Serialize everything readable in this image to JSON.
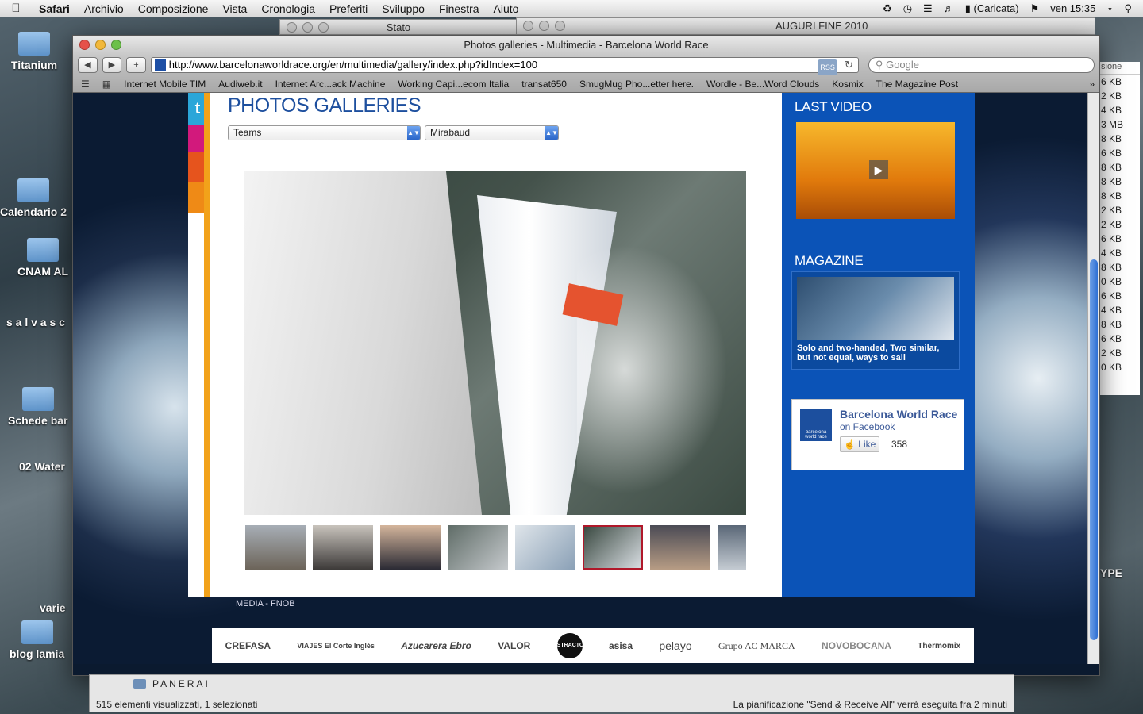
{
  "menubar": {
    "apple": "",
    "items": [
      "Safari",
      "Archivio",
      "Composizione",
      "Vista",
      "Cronologia",
      "Preferiti",
      "Sviluppo",
      "Finestra",
      "Aiuto"
    ],
    "battery": "(Caricata)",
    "clock": "ven 15:35"
  },
  "desktop": {
    "icons": [
      "Titanium",
      "Calendario 2",
      "CNAM AL",
      "s a l v a s c",
      "Schede bar",
      "02 Water",
      "varie",
      "blog lamia"
    ],
    "type_label": "YPE"
  },
  "bg_windows": {
    "stato_title": "Stato",
    "auguri_title": "AUGURI FINE 2010"
  },
  "sidelist": {
    "header": "sione",
    "rows": [
      "6 KB",
      "2 KB",
      "4 KB",
      "3 MB",
      "8 KB",
      "6 KB",
      "8 KB",
      "8 KB",
      "8 KB",
      "2 KB",
      "2 KB",
      "6 KB",
      "4 KB",
      "8 KB",
      "0 KB",
      "6 KB",
      "4 KB",
      "8 KB",
      "6 KB",
      "2 KB",
      "0 KB"
    ]
  },
  "safari": {
    "title": "Photos galleries - Multimedia - Barcelona World Race",
    "url": "http://www.barcelonaworldrace.org/en/multimedia/gallery/index.php?idIndex=100",
    "rss": "RSS",
    "search_placeholder": "Google",
    "bookmarks": [
      "Internet Mobile TIM",
      "Audiweb.it",
      "Internet Arc...ack Machine",
      "Working Capi...ecom Italia",
      "transat650",
      "SmugMug Pho...etter here.",
      "Wordle - Be...Word Clouds",
      "Kosmix",
      "The Magazine Post"
    ]
  },
  "page": {
    "title": "PHOTOS GALLERIES",
    "twitter_glyph": "t",
    "select_category": "Teams",
    "select_team": "Mirabaud",
    "selected_thumb_index": 5,
    "thumb_count": 8,
    "footer_links": "MEDIA  -  FNOB"
  },
  "sidebar": {
    "last_video_title": "LAST VIDEO",
    "magazine_title": "MAGAZINE",
    "magazine_caption": "Solo and two-handed, Two similar, but not equal, ways to sail",
    "fb_logo_text": "barcelona world race",
    "fb_name": "Barcelona World Race",
    "fb_on": "on Facebook",
    "fb_like": "Like",
    "fb_count": "358"
  },
  "sponsors": [
    "CREFASA",
    "VIAJES El Corte Inglés",
    "Azucarera Ebro",
    "VALOR",
    "STRACTO",
    "asisa",
    "pelayo",
    "Grupo AC MARCA",
    "NOVOBOCANA",
    "Thermomix"
  ],
  "finder": {
    "folder": "PANERAI",
    "status_left": "515 elementi visualizzati, 1 selezionati",
    "status_right": "La pianificazione \"Send & Receive All\" verrà eseguita fra 2 minuti"
  },
  "colors": {
    "brand_blue": "#0b53b7",
    "title_blue": "#1d4f9e",
    "accent_orange": "#f2a21a",
    "selected_thumb": "#b0182a"
  }
}
